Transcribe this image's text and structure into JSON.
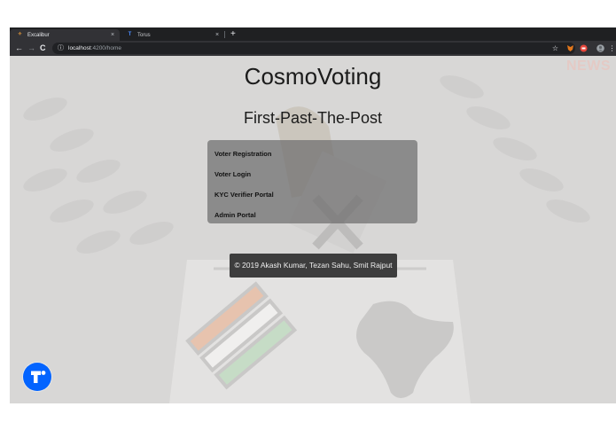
{
  "browser": {
    "tabs": [
      {
        "title": "Excalibur",
        "favicon": "excalibur-favicon",
        "active": true
      },
      {
        "title": "Torus",
        "favicon": "torus-favicon",
        "active": false
      }
    ],
    "url_host": "localhost",
    "url_path": ":4200/home",
    "close_glyph": "×",
    "newtab_glyph": "+"
  },
  "page": {
    "title": "CosmoVoting",
    "subtitle": "First-Past-The-Post",
    "watermark": "NEWS",
    "menu": [
      "Voter Registration",
      "Voter Login",
      "KYC Verifier Portal",
      "Admin Portal"
    ],
    "footer": "© 2019 Akash Kumar, Tezan Sahu, Smit Rajput"
  },
  "colors": {
    "accent": "#0364ff",
    "chrome_dark": "#1f1f21",
    "menu_panel": "#6e6e6e",
    "footer_bg": "#3d3d3d"
  }
}
